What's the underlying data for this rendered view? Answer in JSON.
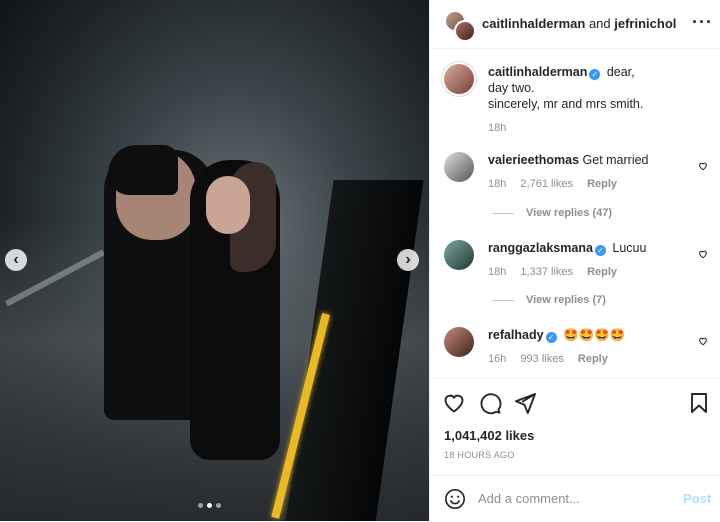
{
  "post": {
    "header": {
      "user1": "caitlinhalderman",
      "joiner": "and",
      "user2": "jefrinichol"
    },
    "caption": {
      "username": "caitlinhalderman",
      "line1": "dear,",
      "line2": "day two.",
      "line3": "sincerely, mr and mrs smith.",
      "time": "18h"
    },
    "comments": [
      {
        "username": "valerieethomas",
        "verified": false,
        "text": "Get married",
        "time": "18h",
        "likes": "2,761 likes",
        "reply": "Reply",
        "view_replies": "View replies (47)"
      },
      {
        "username": "ranggazlaksmana",
        "verified": true,
        "text": "Lucuu",
        "time": "18h",
        "likes": "1,337 likes",
        "reply": "Reply",
        "view_replies": "View replies (7)"
      },
      {
        "username": "refalhady",
        "verified": true,
        "text": "🤩🤩🤩🤩",
        "time": "16h",
        "likes": "993 likes",
        "reply": "Reply"
      }
    ],
    "likes_count": "1,041,402 likes",
    "posted_ago": "18 HOURS AGO",
    "add_comment_placeholder": "Add a comment...",
    "post_label": "Post"
  },
  "carousel": {
    "current": 2,
    "total": 3
  },
  "icons": {
    "more": "more-options-icon",
    "like": "heart-icon",
    "comment": "comment-icon",
    "share": "paper-plane-icon",
    "save": "bookmark-icon",
    "emoji": "smile-icon",
    "verified": "verified-badge-icon"
  },
  "colors": {
    "verified": "#3897f0",
    "post_disabled": "#b2dffc",
    "muted": "#8e8e8e"
  }
}
